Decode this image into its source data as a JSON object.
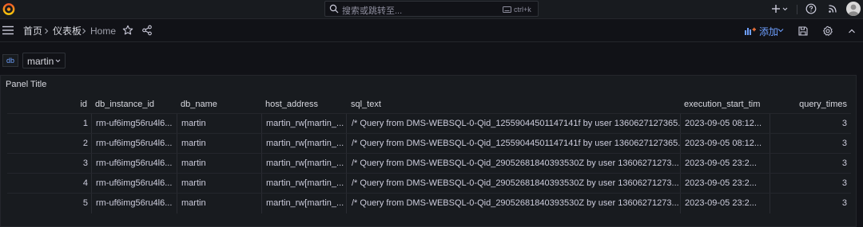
{
  "topbar": {
    "search_placeholder": "搜索或跳转至...",
    "search_shortcut": "ctrl+k",
    "plus_label": "+"
  },
  "navbar": {
    "breadcrumb": [
      "首页",
      "仪表板",
      "Home"
    ],
    "add_label": "添加"
  },
  "variables": {
    "label": "db",
    "selected": "martin"
  },
  "panel": {
    "title": "Panel Title",
    "columns": [
      "id",
      "db_instance_id",
      "db_name",
      "host_address",
      "sql_text",
      "execution_start_tim",
      "query_times"
    ],
    "rows": [
      [
        "1",
        "rm-uf6img56ru4l6...",
        "martin",
        "martin_rw[martin_...",
        "/* Query from DMS-WEBSQL-0-Qid_12559044501147141f by user 1360627127365...",
        "2023-09-05 08:12...",
        "3"
      ],
      [
        "2",
        "rm-uf6img56ru4l6...",
        "martin",
        "martin_rw[martin_...",
        "/* Query from DMS-WEBSQL-0-Qid_12559044501147141f by user 1360627127365...",
        "2023-09-05 08:12...",
        "3"
      ],
      [
        "3",
        "rm-uf6img56ru4l6...",
        "martin",
        "martin_rw[martin_...",
        "/* Query from DMS-WEBSQL-0-Qid_29052681840393530Z by user 13606271273...",
        "2023-09-05 23:2...",
        "3"
      ],
      [
        "4",
        "rm-uf6img56ru4l6...",
        "martin",
        "martin_rw[martin_...",
        "/* Query from DMS-WEBSQL-0-Qid_29052681840393530Z by user 13606271273...",
        "2023-09-05 23:2...",
        "3"
      ],
      [
        "5",
        "rm-uf6img56ru4l6...",
        "martin",
        "martin_rw[martin_...",
        "/* Query from DMS-WEBSQL-0-Qid_29052681840393530Z by user 13606271273...",
        "2023-09-05 23:2...",
        "3"
      ]
    ]
  },
  "colors": {
    "background": "#111217",
    "panel": "#181b1f",
    "accent_blue": "#6e9fff",
    "grafana_orange": "#f05a28"
  }
}
